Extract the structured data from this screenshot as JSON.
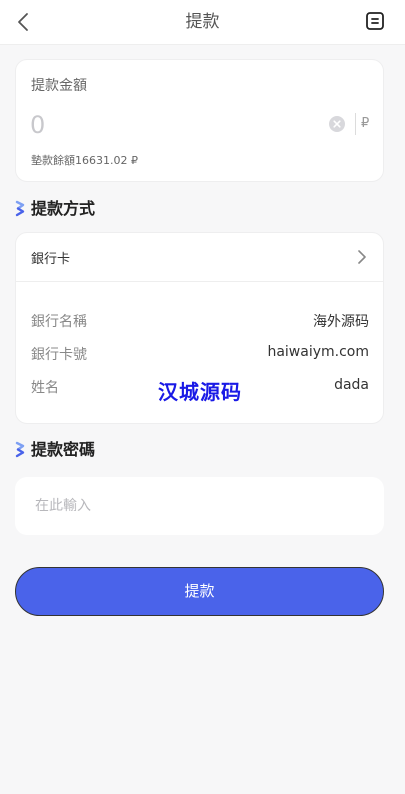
{
  "nav": {
    "title": "提款",
    "back_icon": "chevron-left-icon",
    "record_icon": "record-list-icon"
  },
  "amount": {
    "label": "提款金額",
    "placeholder": "0",
    "currency": "₽",
    "balance": "墊款餘額16631.02 ₽"
  },
  "method": {
    "title": "提款方式",
    "selected": "銀行卡",
    "rows": [
      {
        "key": "銀行名稱",
        "value": "海外源码"
      },
      {
        "key": "銀行卡號",
        "value": "haiwaiym.com"
      },
      {
        "key": "姓名",
        "value": "dada"
      }
    ]
  },
  "watermark": "汉城源码",
  "password": {
    "title": "提款密碼",
    "placeholder": "在此輸入"
  },
  "submit_label": "提款",
  "colors": {
    "accent": "#4a63ea",
    "section_icon": "#6a8ef0",
    "watermark": "#1a1ae6"
  }
}
